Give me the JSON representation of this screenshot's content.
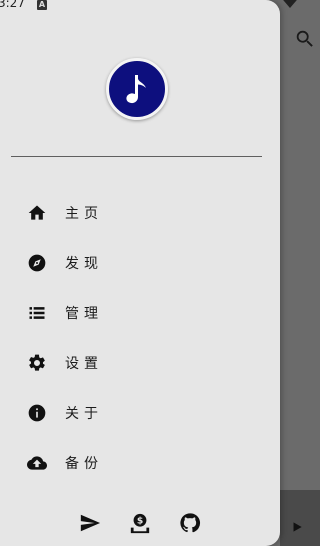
{
  "status_bar": {
    "time": "3:27",
    "notification_badge": "A"
  },
  "drawer": {
    "logo_icon": "music-note-icon",
    "menu": [
      {
        "id": "home",
        "icon": "home-icon",
        "label": "主页"
      },
      {
        "id": "discover",
        "icon": "compass-icon",
        "label": "发现"
      },
      {
        "id": "manage",
        "icon": "list-icon",
        "label": "管理"
      },
      {
        "id": "settings",
        "icon": "gear-icon",
        "label": "设置"
      },
      {
        "id": "about",
        "icon": "info-icon",
        "label": "关于"
      },
      {
        "id": "backup",
        "icon": "cloud-upload-icon",
        "label": "备份"
      }
    ],
    "footer": [
      {
        "id": "telegram",
        "icon": "send-icon"
      },
      {
        "id": "donate",
        "icon": "donate-icon"
      },
      {
        "id": "github",
        "icon": "github-icon"
      }
    ]
  },
  "colors": {
    "drawer_bg": "#e6e6e6",
    "logo_bg": "#0d0f7e",
    "scrim": "#6b6b6b",
    "icon": "#111111"
  }
}
